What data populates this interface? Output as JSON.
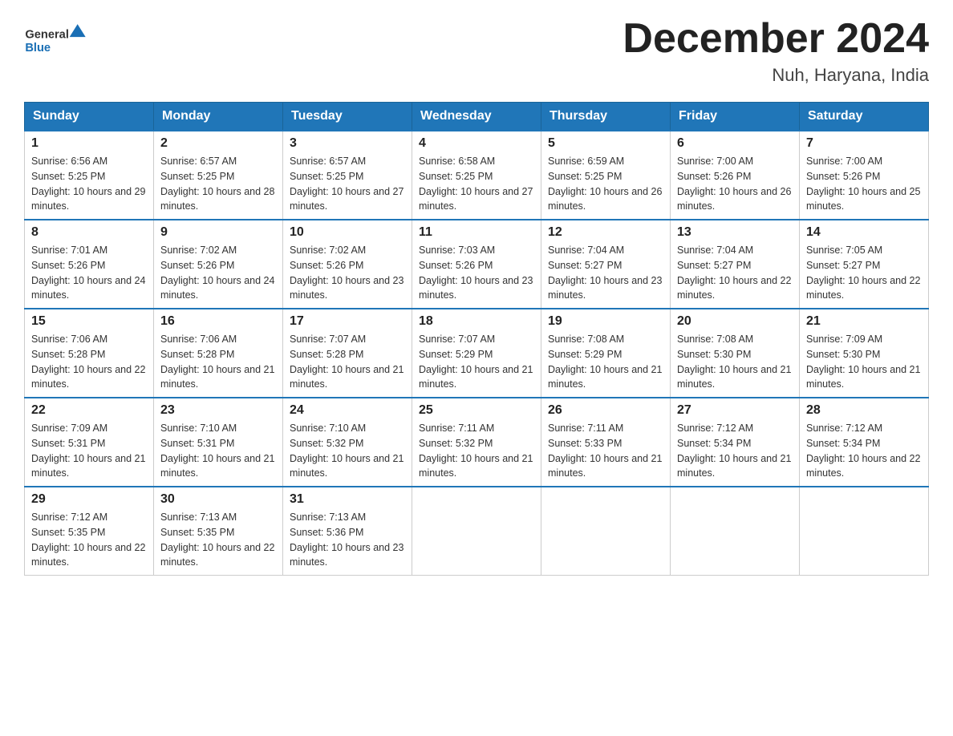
{
  "header": {
    "logo_general": "General",
    "logo_blue": "Blue",
    "title": "December 2024",
    "subtitle": "Nuh, Haryana, India"
  },
  "days_of_week": [
    "Sunday",
    "Monday",
    "Tuesday",
    "Wednesday",
    "Thursday",
    "Friday",
    "Saturday"
  ],
  "weeks": [
    [
      {
        "day": "1",
        "sunrise": "Sunrise: 6:56 AM",
        "sunset": "Sunset: 5:25 PM",
        "daylight": "Daylight: 10 hours and 29 minutes."
      },
      {
        "day": "2",
        "sunrise": "Sunrise: 6:57 AM",
        "sunset": "Sunset: 5:25 PM",
        "daylight": "Daylight: 10 hours and 28 minutes."
      },
      {
        "day": "3",
        "sunrise": "Sunrise: 6:57 AM",
        "sunset": "Sunset: 5:25 PM",
        "daylight": "Daylight: 10 hours and 27 minutes."
      },
      {
        "day": "4",
        "sunrise": "Sunrise: 6:58 AM",
        "sunset": "Sunset: 5:25 PM",
        "daylight": "Daylight: 10 hours and 27 minutes."
      },
      {
        "day": "5",
        "sunrise": "Sunrise: 6:59 AM",
        "sunset": "Sunset: 5:25 PM",
        "daylight": "Daylight: 10 hours and 26 minutes."
      },
      {
        "day": "6",
        "sunrise": "Sunrise: 7:00 AM",
        "sunset": "Sunset: 5:26 PM",
        "daylight": "Daylight: 10 hours and 26 minutes."
      },
      {
        "day": "7",
        "sunrise": "Sunrise: 7:00 AM",
        "sunset": "Sunset: 5:26 PM",
        "daylight": "Daylight: 10 hours and 25 minutes."
      }
    ],
    [
      {
        "day": "8",
        "sunrise": "Sunrise: 7:01 AM",
        "sunset": "Sunset: 5:26 PM",
        "daylight": "Daylight: 10 hours and 24 minutes."
      },
      {
        "day": "9",
        "sunrise": "Sunrise: 7:02 AM",
        "sunset": "Sunset: 5:26 PM",
        "daylight": "Daylight: 10 hours and 24 minutes."
      },
      {
        "day": "10",
        "sunrise": "Sunrise: 7:02 AM",
        "sunset": "Sunset: 5:26 PM",
        "daylight": "Daylight: 10 hours and 23 minutes."
      },
      {
        "day": "11",
        "sunrise": "Sunrise: 7:03 AM",
        "sunset": "Sunset: 5:26 PM",
        "daylight": "Daylight: 10 hours and 23 minutes."
      },
      {
        "day": "12",
        "sunrise": "Sunrise: 7:04 AM",
        "sunset": "Sunset: 5:27 PM",
        "daylight": "Daylight: 10 hours and 23 minutes."
      },
      {
        "day": "13",
        "sunrise": "Sunrise: 7:04 AM",
        "sunset": "Sunset: 5:27 PM",
        "daylight": "Daylight: 10 hours and 22 minutes."
      },
      {
        "day": "14",
        "sunrise": "Sunrise: 7:05 AM",
        "sunset": "Sunset: 5:27 PM",
        "daylight": "Daylight: 10 hours and 22 minutes."
      }
    ],
    [
      {
        "day": "15",
        "sunrise": "Sunrise: 7:06 AM",
        "sunset": "Sunset: 5:28 PM",
        "daylight": "Daylight: 10 hours and 22 minutes."
      },
      {
        "day": "16",
        "sunrise": "Sunrise: 7:06 AM",
        "sunset": "Sunset: 5:28 PM",
        "daylight": "Daylight: 10 hours and 21 minutes."
      },
      {
        "day": "17",
        "sunrise": "Sunrise: 7:07 AM",
        "sunset": "Sunset: 5:28 PM",
        "daylight": "Daylight: 10 hours and 21 minutes."
      },
      {
        "day": "18",
        "sunrise": "Sunrise: 7:07 AM",
        "sunset": "Sunset: 5:29 PM",
        "daylight": "Daylight: 10 hours and 21 minutes."
      },
      {
        "day": "19",
        "sunrise": "Sunrise: 7:08 AM",
        "sunset": "Sunset: 5:29 PM",
        "daylight": "Daylight: 10 hours and 21 minutes."
      },
      {
        "day": "20",
        "sunrise": "Sunrise: 7:08 AM",
        "sunset": "Sunset: 5:30 PM",
        "daylight": "Daylight: 10 hours and 21 minutes."
      },
      {
        "day": "21",
        "sunrise": "Sunrise: 7:09 AM",
        "sunset": "Sunset: 5:30 PM",
        "daylight": "Daylight: 10 hours and 21 minutes."
      }
    ],
    [
      {
        "day": "22",
        "sunrise": "Sunrise: 7:09 AM",
        "sunset": "Sunset: 5:31 PM",
        "daylight": "Daylight: 10 hours and 21 minutes."
      },
      {
        "day": "23",
        "sunrise": "Sunrise: 7:10 AM",
        "sunset": "Sunset: 5:31 PM",
        "daylight": "Daylight: 10 hours and 21 minutes."
      },
      {
        "day": "24",
        "sunrise": "Sunrise: 7:10 AM",
        "sunset": "Sunset: 5:32 PM",
        "daylight": "Daylight: 10 hours and 21 minutes."
      },
      {
        "day": "25",
        "sunrise": "Sunrise: 7:11 AM",
        "sunset": "Sunset: 5:32 PM",
        "daylight": "Daylight: 10 hours and 21 minutes."
      },
      {
        "day": "26",
        "sunrise": "Sunrise: 7:11 AM",
        "sunset": "Sunset: 5:33 PM",
        "daylight": "Daylight: 10 hours and 21 minutes."
      },
      {
        "day": "27",
        "sunrise": "Sunrise: 7:12 AM",
        "sunset": "Sunset: 5:34 PM",
        "daylight": "Daylight: 10 hours and 21 minutes."
      },
      {
        "day": "28",
        "sunrise": "Sunrise: 7:12 AM",
        "sunset": "Sunset: 5:34 PM",
        "daylight": "Daylight: 10 hours and 22 minutes."
      }
    ],
    [
      {
        "day": "29",
        "sunrise": "Sunrise: 7:12 AM",
        "sunset": "Sunset: 5:35 PM",
        "daylight": "Daylight: 10 hours and 22 minutes."
      },
      {
        "day": "30",
        "sunrise": "Sunrise: 7:13 AM",
        "sunset": "Sunset: 5:35 PM",
        "daylight": "Daylight: 10 hours and 22 minutes."
      },
      {
        "day": "31",
        "sunrise": "Sunrise: 7:13 AM",
        "sunset": "Sunset: 5:36 PM",
        "daylight": "Daylight: 10 hours and 23 minutes."
      },
      null,
      null,
      null,
      null
    ]
  ]
}
